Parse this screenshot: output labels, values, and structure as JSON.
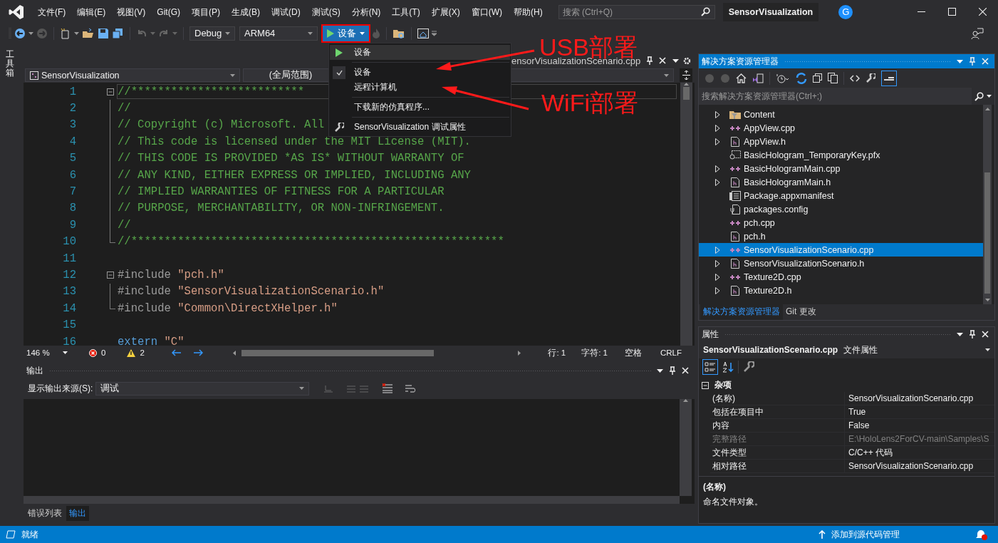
{
  "menu_bar": {
    "items": [
      "文件(F)",
      "编辑(E)",
      "视图(V)",
      "Git(G)",
      "项目(P)",
      "生成(B)",
      "调试(D)",
      "测试(S)",
      "分析(N)",
      "工具(T)",
      "扩展(X)",
      "窗口(W)",
      "帮助(H)"
    ],
    "search": {
      "placeholder": "搜索 (Ctrl+Q)"
    },
    "solution_name": "SensorVisualization",
    "account_initial": "G"
  },
  "toolbar": {
    "configuration": "Debug",
    "platform": "ARM64",
    "run_button": {
      "label": "设备",
      "highlighted": true
    }
  },
  "toolbox_tab": "工具箱",
  "run_menu": {
    "items": [
      {
        "kind": "run",
        "label": "设备",
        "hovered": true
      },
      {
        "kind": "option",
        "label": "设备",
        "checked": true,
        "hovered": false
      },
      {
        "kind": "option",
        "label": "远程计算机",
        "checked": false,
        "hovered": false
      },
      {
        "kind": "action",
        "label": "下载新的仿真程序...",
        "hovered": false
      },
      {
        "kind": "settings",
        "label": "SensorVisualization 调试属性",
        "hovered": false
      }
    ]
  },
  "editor": {
    "tab": "ensorVisualizationScenario.cpp",
    "nav": {
      "project": "SensorVisualization",
      "scope": "(全局范围)"
    },
    "lines": [
      {
        "number": "1",
        "kind": "opener",
        "current": true,
        "segments": [
          {
            "kind": "comment",
            "text": "//**************************"
          }
        ]
      },
      {
        "number": "2",
        "kind": "inner",
        "current": false,
        "segments": [
          {
            "kind": "comment",
            "text": "//"
          }
        ]
      },
      {
        "number": "3",
        "kind": "inner",
        "current": false,
        "segments": [
          {
            "kind": "comment",
            "text": "// Copyright (c) Microsoft. All"
          }
        ]
      },
      {
        "number": "4",
        "kind": "inner",
        "current": false,
        "segments": [
          {
            "kind": "comment",
            "text": "// This code is licensed under the MIT License (MIT)."
          }
        ]
      },
      {
        "number": "5",
        "kind": "inner",
        "current": false,
        "segments": [
          {
            "kind": "comment",
            "text": "// THIS CODE IS PROVIDED *AS IS* WITHOUT WARRANTY OF"
          }
        ]
      },
      {
        "number": "6",
        "kind": "inner",
        "current": false,
        "segments": [
          {
            "kind": "comment",
            "text": "// ANY KIND, EITHER EXPRESS OR IMPLIED, INCLUDING ANY"
          }
        ]
      },
      {
        "number": "7",
        "kind": "inner",
        "current": false,
        "segments": [
          {
            "kind": "comment",
            "text": "// IMPLIED WARRANTIES OF FITNESS FOR A PARTICULAR"
          }
        ]
      },
      {
        "number": "8",
        "kind": "inner",
        "current": false,
        "segments": [
          {
            "kind": "comment",
            "text": "// PURPOSE, MERCHANTABILITY, OR NON-INFRINGEMENT."
          }
        ]
      },
      {
        "number": "9",
        "kind": "inner",
        "current": false,
        "segments": [
          {
            "kind": "comment",
            "text": "//"
          }
        ]
      },
      {
        "number": "10",
        "kind": "closer",
        "current": false,
        "segments": [
          {
            "kind": "comment",
            "text": "//********************************************************"
          }
        ]
      },
      {
        "number": "11",
        "kind": "plain",
        "current": false
      },
      {
        "number": "12",
        "kind": "opener",
        "current": false,
        "segments": [
          {
            "kind": "directive",
            "text": "#include "
          },
          {
            "kind": "string",
            "text": "\"pch.h\""
          }
        ]
      },
      {
        "number": "13",
        "kind": "inner",
        "current": false,
        "segments": [
          {
            "kind": "directive",
            "text": "#include "
          },
          {
            "kind": "string",
            "text": "\"SensorVisualizationScenario.h\""
          }
        ]
      },
      {
        "number": "14",
        "kind": "closer",
        "current": false,
        "segments": [
          {
            "kind": "directive",
            "text": "#include "
          },
          {
            "kind": "string",
            "text": "\"Common\\DirectXHelper.h\""
          }
        ]
      },
      {
        "number": "15",
        "kind": "plain",
        "current": false
      },
      {
        "number": "16",
        "kind": "plain",
        "current": false,
        "segments": [
          {
            "kind": "keyword",
            "text": "extern "
          },
          {
            "kind": "string",
            "text": "\"C\""
          }
        ]
      }
    ],
    "status": {
      "zoom": "146 %",
      "errors": "0",
      "warnings": "2",
      "line": "行: 1",
      "char": "字符: 1",
      "indent": "空格",
      "line_ending": "CRLF"
    }
  },
  "output": {
    "title": "输出",
    "source_label": "显示输出来源(S):",
    "source": "调试"
  },
  "bottom_tabs": [
    {
      "label": "错误列表",
      "selected": false
    },
    {
      "label": "输出",
      "selected": true
    }
  ],
  "solution_explorer": {
    "title": "解决方案资源管理器",
    "search": {
      "placeholder": "搜索解决方案资源管理器(Ctrl+;)"
    },
    "items": [
      {
        "label": "Content",
        "kind": "filter",
        "expandable": true,
        "selected": false
      },
      {
        "label": "AppView.cpp",
        "kind": "cpp",
        "expandable": true,
        "selected": false
      },
      {
        "label": "AppView.h",
        "kind": "header",
        "expandable": true,
        "selected": false
      },
      {
        "label": "BasicHologram_TemporaryKey.pfx",
        "kind": "certificate",
        "expandable": false,
        "selected": false
      },
      {
        "label": "BasicHologramMain.cpp",
        "kind": "cpp",
        "expandable": true,
        "selected": false
      },
      {
        "label": "BasicHologramMain.h",
        "kind": "header",
        "expandable": true,
        "selected": false
      },
      {
        "label": "Package.appxmanifest",
        "kind": "manifest",
        "expandable": false,
        "selected": false
      },
      {
        "label": "packages.config",
        "kind": "config",
        "expandable": false,
        "selected": false
      },
      {
        "label": "pch.cpp",
        "kind": "cpp",
        "expandable": false,
        "selected": false
      },
      {
        "label": "pch.h",
        "kind": "header",
        "expandable": false,
        "selected": false
      },
      {
        "label": "SensorVisualizationScenario.cpp",
        "kind": "cpp",
        "expandable": true,
        "selected": true
      },
      {
        "label": "SensorVisualizationScenario.h",
        "kind": "header",
        "expandable": true,
        "selected": false
      },
      {
        "label": "Texture2D.cpp",
        "kind": "cpp",
        "expandable": true,
        "selected": false
      },
      {
        "label": "Texture2D.h",
        "kind": "header",
        "expandable": true,
        "selected": false
      }
    ],
    "tabs": [
      {
        "label": "解决方案资源管理器",
        "selected": true
      },
      {
        "label": "Git 更改",
        "selected": false
      }
    ]
  },
  "properties": {
    "title": "属性",
    "object": "SensorVisualizationScenario.cpp",
    "object_type": "文件属性",
    "category": "杂项",
    "rows": [
      {
        "name": "(名称)",
        "value": "SensorVisualizationScenario.cpp",
        "disabled": false
      },
      {
        "name": "包括在项目中",
        "value": "True",
        "disabled": false
      },
      {
        "name": "内容",
        "value": "False",
        "disabled": false
      },
      {
        "name": "完整路径",
        "value": "E:\\HoloLens2ForCV-main\\Samples\\S",
        "disabled": true
      },
      {
        "name": "文件类型",
        "value": "C/C++ 代码",
        "disabled": false
      },
      {
        "name": "相对路径",
        "value": "SensorVisualizationScenario.cpp",
        "disabled": false
      }
    ],
    "description": {
      "title": "(名称)",
      "text": "命名文件对象。"
    }
  },
  "status_bar": {
    "text": "就绪",
    "source_control": "添加到源代码管理"
  },
  "annotations": [
    {
      "text": "USB部署"
    },
    {
      "text": "WiFi部署"
    }
  ]
}
